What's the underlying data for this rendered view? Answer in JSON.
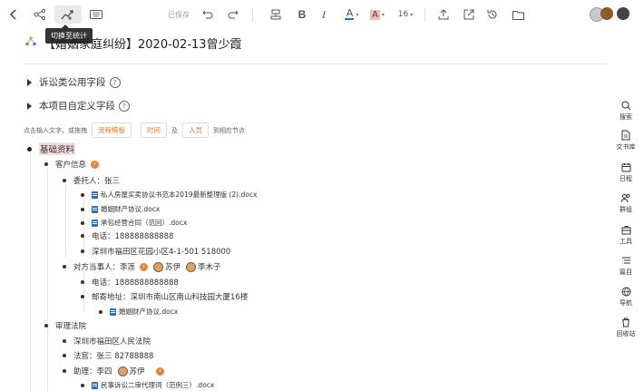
{
  "toolbar": {
    "tooltip": "切换至统计",
    "saved": "已保存",
    "font_size": "16",
    "color_letter": "A",
    "bg_letter": "A",
    "bold": "B",
    "italic": "I",
    "font_color": "#2b6cd4",
    "bg_color": "#f08a8a"
  },
  "title": "【婚姻家庭纠纷】2020-02-13曾少霞",
  "sections": {
    "public_fields": "诉讼类公用字段",
    "custom_fields": "本项目自定义字段"
  },
  "hint": {
    "prefix": "点击输入文字，或拖拽",
    "chip_flow": "流程模板",
    "chip_time": "时间",
    "and": "及",
    "chip_person": "人员",
    "suffix": "到相应节点"
  },
  "tree": {
    "root": "基础资料",
    "client": "客户信息",
    "entrusted": "委托人：张三",
    "doc1": "私人房屋买卖协议书范本2019最新整理版 (2).docx",
    "doc2": "婚姻财产协议.docx",
    "doc3": "承包经营合同（范回）.docx",
    "phone1": "电话：188888888888",
    "addr1": "深圳市福田区花园小区4-1-501 518000",
    "opponent": "对方当事人：李莲",
    "person_su": "苏伊",
    "person_li": "李木子",
    "phone2": "电话：1888888888888",
    "mail": "邮寄地址：深圳市南山区南山科技园大厦16楼",
    "doc4": "婚姻财产协议.docx",
    "court_section": "审理法院",
    "court": "深圳市福田区人民法院",
    "judge": "法官：张三 82788888",
    "assistant": "助理：李四",
    "person_su2": "苏伊",
    "doc5": "民事诉讼二审代理词（范例三）.docx"
  },
  "sidebar": [
    {
      "label": "搜索",
      "icon": "search-icon"
    },
    {
      "label": "文书库",
      "icon": "document-icon"
    },
    {
      "label": "日程",
      "icon": "calendar-icon"
    },
    {
      "label": "群组",
      "icon": "group-icon"
    },
    {
      "label": "工具",
      "icon": "tools-icon"
    },
    {
      "label": "篇目",
      "icon": "outline-icon"
    },
    {
      "label": "导航",
      "icon": "compass-icon"
    },
    {
      "label": "回收站",
      "icon": "trash-icon"
    }
  ]
}
